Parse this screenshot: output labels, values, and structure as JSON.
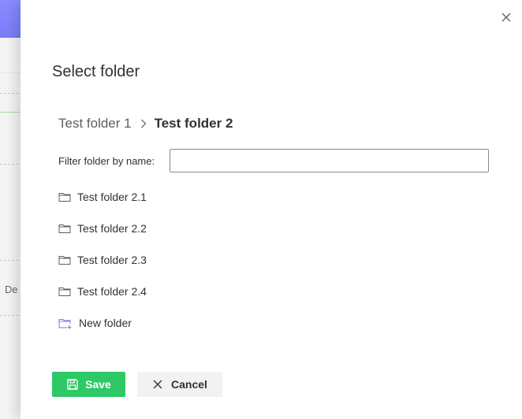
{
  "background_app": {
    "partial_text": "De"
  },
  "panel": {
    "title": "Select folder",
    "breadcrumb": {
      "parent": "Test folder 1",
      "current": "Test folder 2"
    },
    "filter": {
      "label": "Filter folder by name:",
      "value": "",
      "placeholder": ""
    },
    "folders": [
      {
        "label": "Test folder 2.1",
        "icon": "folder-icon"
      },
      {
        "label": "Test folder 2.2",
        "icon": "folder-icon"
      },
      {
        "label": "Test folder 2.3",
        "icon": "folder-icon"
      },
      {
        "label": "Test folder 2.4",
        "icon": "folder-icon"
      }
    ],
    "new_folder": {
      "label": "New folder",
      "icon": "new-folder-icon"
    },
    "actions": {
      "save_label": "Save",
      "save_icon": "save-icon",
      "cancel_label": "Cancel",
      "cancel_icon": "close-icon"
    }
  },
  "colors": {
    "accent_primary": "#2ec866",
    "accent_purple": "#7a78d8",
    "header_strip": "#8a8cff",
    "text_primary": "#323130",
    "text_secondary": "#605e5c",
    "secondary_button_bg": "#f3f2f1"
  }
}
